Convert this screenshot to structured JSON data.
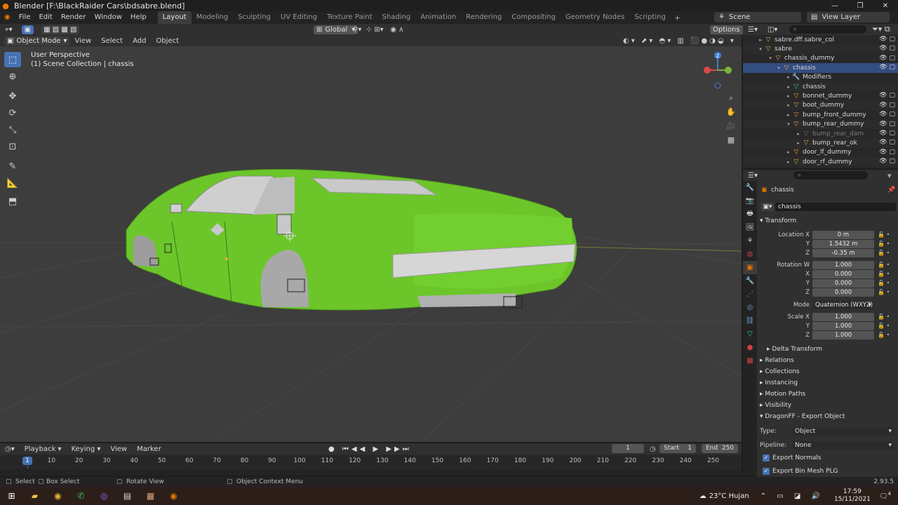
{
  "window": {
    "title": "Blender [F:\\BlackRaider Cars\\bdsabre.blend]"
  },
  "menu": [
    "File",
    "Edit",
    "Render",
    "Window",
    "Help"
  ],
  "workspaces": [
    "Layout",
    "Modeling",
    "Sculpting",
    "UV Editing",
    "Texture Paint",
    "Shading",
    "Animation",
    "Rendering",
    "Compositing",
    "Geometry Nodes",
    "Scripting"
  ],
  "scene": "Scene",
  "view_layer": "View Layer",
  "viewport": {
    "orientation": "Global",
    "options": "Options",
    "mode": "Object Mode",
    "menus": [
      "View",
      "Select",
      "Add",
      "Object"
    ],
    "info_line1": "User Perspective",
    "info_line2": "(1) Scene Collection | chassis",
    "gizmo_z": "Z"
  },
  "outliner": {
    "rows": [
      {
        "label": "sabre.dff.sabre_col",
        "arrow": "▸",
        "icon": "▽",
        "icon_color": "#e8a34b"
      },
      {
        "label": "sabre",
        "arrow": "▾",
        "icon": "▽",
        "icon_color": "#e8a34b"
      },
      {
        "label": "chassis_dummy",
        "arrow": "▾",
        "icon": "▽",
        "icon_color": "#e8a34b"
      },
      {
        "label": "chassis",
        "arrow": "▾",
        "icon": "▽",
        "icon_color": "#e8a34b"
      },
      {
        "label": "Modifiers",
        "arrow": "▸",
        "icon": "🔧",
        "icon_color": "#6fa3e0"
      },
      {
        "label": "chassis",
        "arrow": "▸",
        "icon": "▽",
        "icon_color": "#2cc2a5"
      },
      {
        "label": "bonnet_dummy",
        "arrow": "▸",
        "icon": "▽",
        "icon_color": "#e8a34b"
      },
      {
        "label": "boot_dummy",
        "arrow": "▸",
        "icon": "▽",
        "icon_color": "#e8a34b"
      },
      {
        "label": "bump_front_dummy",
        "arrow": "▸",
        "icon": "▽",
        "icon_color": "#e8a34b"
      },
      {
        "label": "bump_rear_dummy",
        "arrow": "▾",
        "icon": "▽",
        "icon_color": "#e8a34b"
      },
      {
        "label": "bump_rear_dam",
        "arrow": "▸",
        "icon": "▽",
        "icon_color": "#8a6a40"
      },
      {
        "label": "bump_rear_ok",
        "arrow": "▸",
        "icon": "▽",
        "icon_color": "#e8a34b"
      },
      {
        "label": "door_lf_dummy",
        "arrow": "▸",
        "icon": "▽",
        "icon_color": "#e8a34b"
      },
      {
        "label": "door_rf_dummy",
        "arrow": "▸",
        "icon": "▽",
        "icon_color": "#e8a34b"
      }
    ]
  },
  "properties": {
    "object_name": "chassis",
    "name_field": "chassis",
    "transform_label": "Transform",
    "location": {
      "label": "Location X",
      "x": "0 m",
      "y": "1.5432 m",
      "z": "-0.35 m"
    },
    "rotation": {
      "label": "Rotation W",
      "w": "1.000",
      "x": "0.000",
      "y": "0.000",
      "z": "0.000"
    },
    "mode": {
      "label": "Mode",
      "value": "Quaternion (WXYZ)"
    },
    "scale": {
      "label": "Scale X",
      "x": "1.000",
      "y": "1.000",
      "z": "1.000"
    },
    "axis_labels": {
      "x": "X",
      "y": "Y",
      "z": "Z"
    },
    "delta_transform": "Delta Transform",
    "sections": [
      "Relations",
      "Collections",
      "Instancing",
      "Motion Paths",
      "Visibility"
    ],
    "dragonff": {
      "title": "DragonFF - Export Object",
      "type_label": "Type:",
      "type_value": "Object",
      "pipeline_label": "Pipeline:",
      "pipeline_value": "None",
      "export_normals": "Export Normals",
      "export_bin_mesh": "Export Bin Mesh PLG"
    }
  },
  "timeline": {
    "menus": [
      "Playback",
      "Keying",
      "View",
      "Marker"
    ],
    "current_frame": "1",
    "start_label": "Start",
    "start": "1",
    "end_label": "End",
    "end": "250",
    "ticks": [
      "1",
      "10",
      "20",
      "30",
      "40",
      "50",
      "60",
      "70",
      "80",
      "90",
      "100",
      "110",
      "120",
      "130",
      "140",
      "150",
      "160",
      "170",
      "180",
      "190",
      "200",
      "210",
      "220",
      "230",
      "240",
      "250"
    ]
  },
  "statusbar": {
    "select": "Select",
    "box_select": "Box Select",
    "rotate_view": "Rotate View",
    "context_menu": "Object Context Menu",
    "version": "2.93.5"
  },
  "taskbar": {
    "weather": "23°C  Hujan",
    "time": "17:59",
    "date": "15/11/2021",
    "notifications": "4"
  },
  "colors": {
    "accent": "#4772b3",
    "car_body": "#6cc62a",
    "car_trim": "#b8b8b8",
    "blender_orange": "#ea7600"
  }
}
